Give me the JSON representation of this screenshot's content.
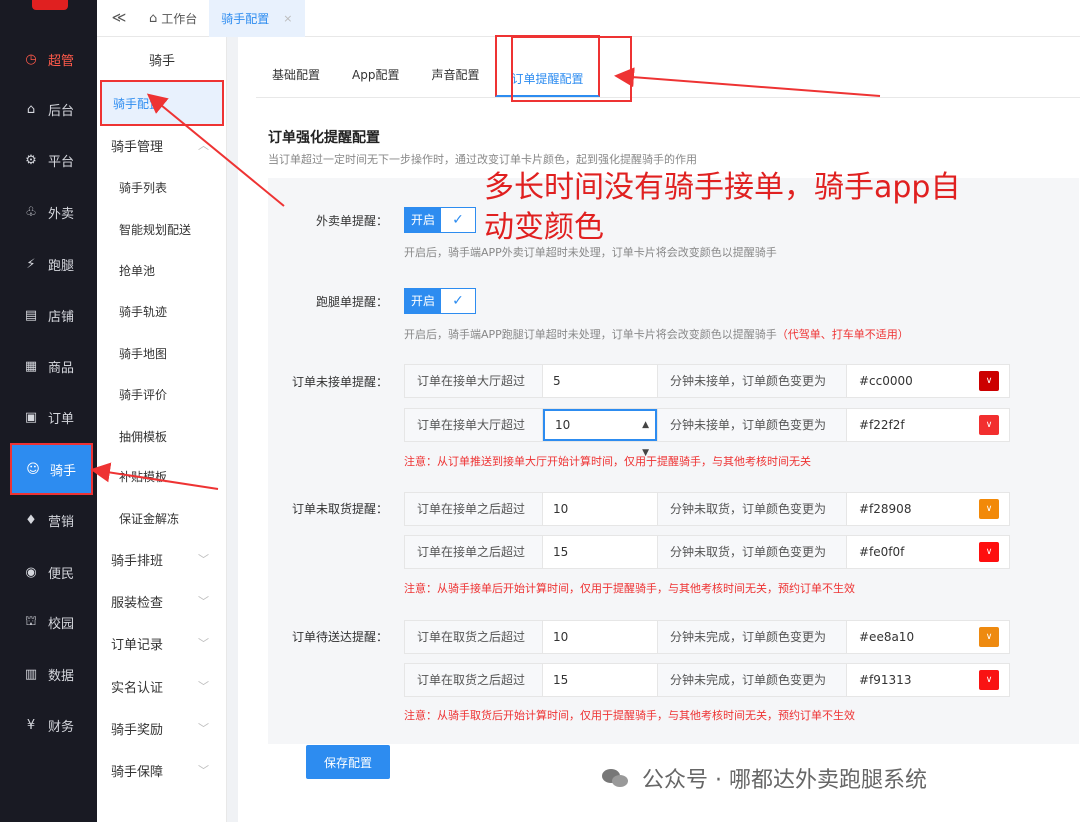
{
  "nav": {
    "items": [
      {
        "icon": "clock-icon",
        "glyph": "◷",
        "label": "超管"
      },
      {
        "icon": "home-icon",
        "glyph": "⌂",
        "label": "后台"
      },
      {
        "icon": "gear-icon",
        "glyph": "⚙",
        "label": "平台"
      },
      {
        "icon": "delivery-icon",
        "glyph": "♧",
        "label": "外卖"
      },
      {
        "icon": "runner-icon",
        "glyph": "⚡",
        "label": "跑腿"
      },
      {
        "icon": "store-icon",
        "glyph": "▤",
        "label": "店铺"
      },
      {
        "icon": "goods-icon",
        "glyph": "▦",
        "label": "商品"
      },
      {
        "icon": "order-icon",
        "glyph": "▣",
        "label": "订单"
      },
      {
        "icon": "rider-icon",
        "glyph": "☺",
        "label": "骑手"
      },
      {
        "icon": "marketing-icon",
        "glyph": "♦",
        "label": "营销"
      },
      {
        "icon": "service-icon",
        "glyph": "◉",
        "label": "便民"
      },
      {
        "icon": "campus-icon",
        "glyph": "⛫",
        "label": "校园"
      },
      {
        "icon": "data-icon",
        "glyph": "▥",
        "label": "数据"
      },
      {
        "icon": "finance-icon",
        "glyph": "¥",
        "label": "财务"
      }
    ]
  },
  "topbar": {
    "collapse_glyph": "≪",
    "home_glyph": "⌂",
    "home_label": "工作台",
    "open_tab": "骑手配置",
    "close_glyph": "×"
  },
  "subnav": {
    "title": "骑手",
    "items": [
      {
        "label": "骑手配置"
      },
      {
        "label": "骑手管理",
        "chev": "︿"
      },
      {
        "label": "骑手列表"
      },
      {
        "label": "智能规划配送"
      },
      {
        "label": "抢单池"
      },
      {
        "label": "骑手轨迹"
      },
      {
        "label": "骑手地图"
      },
      {
        "label": "骑手评价"
      },
      {
        "label": "抽佣模板"
      },
      {
        "label": "补贴模板"
      },
      {
        "label": "保证金解冻"
      },
      {
        "label": "骑手排班",
        "chev": "﹀"
      },
      {
        "label": "服装检查",
        "chev": "﹀"
      },
      {
        "label": "订单记录",
        "chev": "﹀"
      },
      {
        "label": "实名认证",
        "chev": "﹀"
      },
      {
        "label": "骑手奖励",
        "chev": "﹀"
      },
      {
        "label": "骑手保障",
        "chev": "﹀"
      }
    ]
  },
  "tabs": [
    "基础配置",
    "App配置",
    "声音配置",
    "订单提醒配置"
  ],
  "section": {
    "title": "订单强化提醒配置",
    "desc": "当订单超过一定时间无下一步操作时，通过改变订单卡片颜色，起到强化提醒骑手的作用"
  },
  "takeaway": {
    "label": "外卖单提醒：",
    "switch_on": "开启",
    "check": "✓",
    "hint": "开启后，骑手端APP外卖订单超时未处理，订单卡片将会改变颜色以提醒骑手"
  },
  "errand": {
    "label": "跑腿单提醒：",
    "switch_on": "开启",
    "check": "✓",
    "hint": "开启后，骑手端APP跑腿订单超时未处理，订单卡片将会改变颜色以提醒骑手",
    "hint_warn": "（代驾单、打车单不适用）"
  },
  "groups": [
    {
      "label": "订单未接单提醒：",
      "rows": [
        {
          "pre": "订单在接单大厅超过",
          "value": "5",
          "mid": "分钟未接单，订单颜色变更为",
          "hex": "#cc0000",
          "color": "#cc0000"
        },
        {
          "pre": "订单在接单大厅超过",
          "value": "10",
          "mid": "分钟未接单，订单颜色变更为",
          "hex": "#f22f2f",
          "color": "#f22f2f"
        }
      ],
      "note": "注意：从订单推送到接单大厅开始计算时间，仅用于提醒骑手，与其他考核时间无关"
    },
    {
      "label": "订单未取货提醒：",
      "rows": [
        {
          "pre": "订单在接单之后超过",
          "value": "10",
          "mid": "分钟未取货，订单颜色变更为",
          "hex": "#f28908",
          "color": "#f28908"
        },
        {
          "pre": "订单在接单之后超过",
          "value": "15",
          "mid": "分钟未取货，订单颜色变更为",
          "hex": "#fe0f0f",
          "color": "#fe0f0f"
        }
      ],
      "note": "注意：从骑手接单后开始计算时间，仅用于提醒骑手，与其他考核时间无关，预约订单不生效"
    },
    {
      "label": "订单待送达提醒：",
      "rows": [
        {
          "pre": "订单在取货之后超过",
          "value": "10",
          "mid": "分钟未完成，订单颜色变更为",
          "hex": "#ee8a10",
          "color": "#ee8a10"
        },
        {
          "pre": "订单在取货之后超过",
          "value": "15",
          "mid": "分钟未完成，订单颜色变更为",
          "hex": "#f91313",
          "color": "#f91313"
        }
      ],
      "note": "注意：从骑手取货后开始计算时间，仅用于提醒骑手，与其他考核时间无关，预约订单不生效"
    }
  ],
  "save_label": "保存配置",
  "annotation": "多长时间没有骑手接单，骑手app自动变颜色",
  "watermark": "公众号 · 哪都达外卖跑腿系统",
  "colors": {
    "primary": "#2d8cf0",
    "annot_red": "#e33333",
    "nav_bg": "#191a23"
  }
}
